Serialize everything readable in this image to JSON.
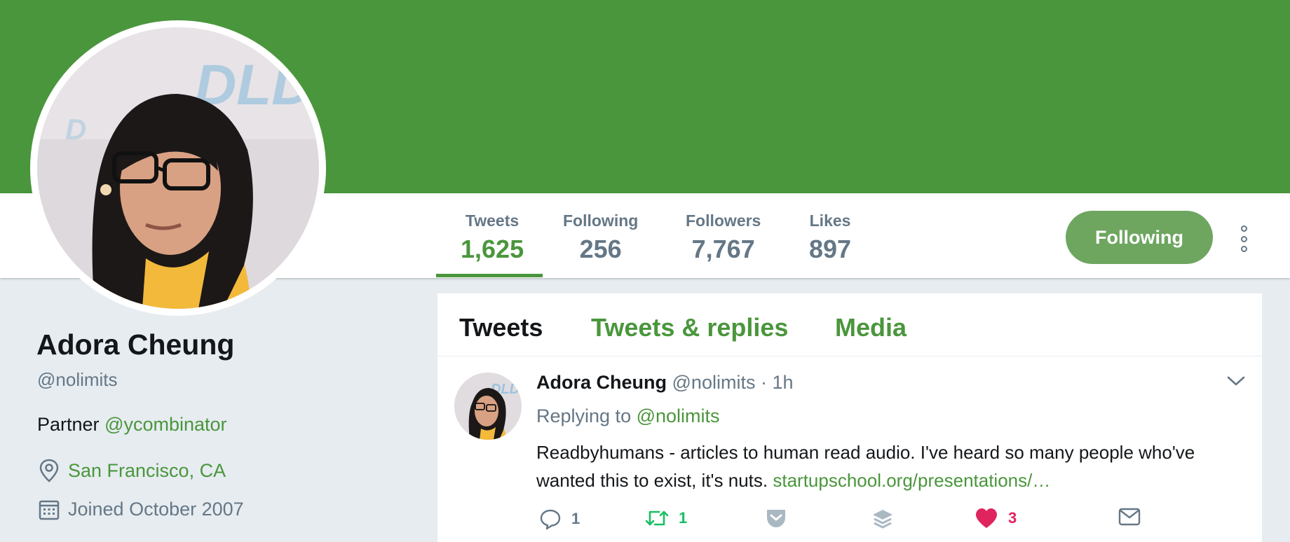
{
  "profile": {
    "name": "Adora Cheung",
    "handle": "@nolimits",
    "bio_prefix": "Partner",
    "bio_mention": "@ycombinator",
    "location": "San Francisco, CA",
    "joined": "Joined October 2007"
  },
  "stats": [
    {
      "label": "Tweets",
      "value": "1,625",
      "active": true
    },
    {
      "label": "Following",
      "value": "256"
    },
    {
      "label": "Followers",
      "value": "7,767"
    },
    {
      "label": "Likes",
      "value": "897"
    }
  ],
  "follow_button": "Following",
  "tabs": [
    "Tweets",
    "Tweets & replies",
    "Media"
  ],
  "active_tab": "Tweets",
  "tweet": {
    "name": "Adora Cheung",
    "handle": "@nolimits",
    "separator": "·",
    "time": "1h",
    "reply_prefix": "Replying to",
    "reply_handle": "@nolimits",
    "text": "Readbyhumans - articles to human read audio. I've heard so many people who've wanted this to exist, it's nuts.",
    "link": "startupschool.org/presentations/…",
    "actions": {
      "replies": "1",
      "retweets": "1",
      "likes": "3"
    }
  },
  "colors": {
    "brand_green": "#4a963c",
    "button_green": "#6ea660",
    "like_red": "#e0245e",
    "retweet_green": "#17bf63",
    "muted": "#657786"
  },
  "icons": [
    "location-pin-icon",
    "calendar-icon",
    "more-options-icon",
    "chevron-down-icon",
    "reply-icon",
    "retweet-icon",
    "pocket-icon",
    "layers-icon",
    "heart-icon",
    "mail-icon"
  ]
}
